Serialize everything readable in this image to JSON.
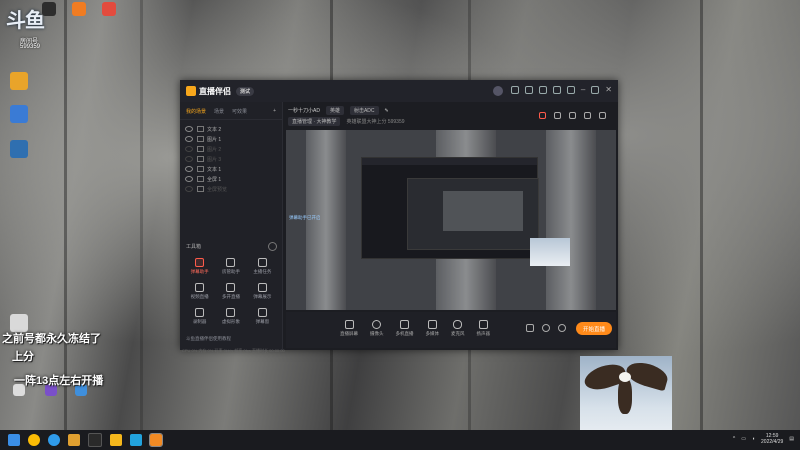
{
  "desktop": {
    "logo_text": "斗鱼",
    "room_label": "房间号",
    "room_number": "599359",
    "overlay_lines": [
      "之前号都永久冻结了",
      "上分",
      "一阵13点左右开播"
    ]
  },
  "app": {
    "title": "直播伴侣",
    "version": "测试",
    "tabs": [
      "我的场景",
      "场景",
      "可效果"
    ],
    "sources": [
      {
        "label": "文本 2",
        "visible": true
      },
      {
        "label": "图片 1",
        "visible": true
      },
      {
        "label": "图片 2",
        "visible": false
      },
      {
        "label": "图片 3",
        "visible": false
      },
      {
        "label": "文本 1",
        "visible": true
      },
      {
        "label": "全屏 1",
        "visible": true
      },
      {
        "label": "全屏预览",
        "visible": false
      }
    ],
    "tools_header": "工具箱",
    "tools": [
      {
        "label": "弹幕助手",
        "highlight": true
      },
      {
        "label": "房管助手",
        "highlight": false
      },
      {
        "label": "主播任务",
        "highlight": false
      },
      {
        "label": "视频直播",
        "highlight": false
      },
      {
        "label": "多开直播",
        "highlight": false
      },
      {
        "label": "弹幕展示",
        "highlight": false
      },
      {
        "label": "录制器",
        "highlight": false
      },
      {
        "label": "虚拟形象",
        "highlight": false
      },
      {
        "label": "弹幕窗",
        "highlight": false
      }
    ],
    "left_footer": "斗鱼直播伴侣使用教程",
    "header": {
      "title": "一秒十刀小AD",
      "category_pill": "英雄",
      "tag_pill": "射击ADC",
      "sub_pill": "直播管理 · 大神教学",
      "sub_text": "英雄联盟大神上分 599359"
    },
    "bottom_tools": [
      "直播屏幕",
      "摄像头",
      "多机直播",
      "多媒体",
      "麦克风",
      "扬声器"
    ],
    "live_button": "开始直播",
    "status_text": "CPU 0% 内存 0% 码率 0kb/s 帧率 0fps 直播时长 00:00:00",
    "preview_chat": "弹幕助手已开启"
  },
  "taskbar": {
    "time": "12:59",
    "date": "2022/4/29"
  }
}
